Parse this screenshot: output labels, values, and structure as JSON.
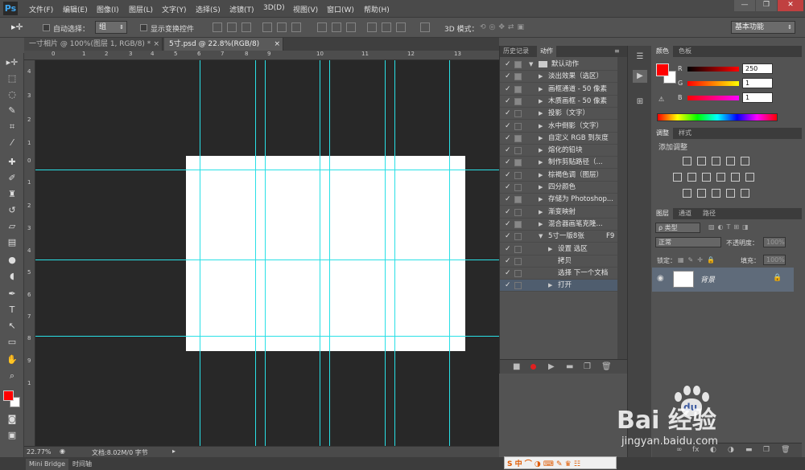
{
  "app": {
    "logo": "Ps"
  },
  "menu": [
    "文件(F)",
    "编辑(E)",
    "图像(I)",
    "图层(L)",
    "文字(Y)",
    "选择(S)",
    "滤镜(T)",
    "3D(D)",
    "视图(V)",
    "窗口(W)",
    "帮助(H)"
  ],
  "window_buttons": {
    "minimize": "—",
    "restore": "❐",
    "close": "✕"
  },
  "options": {
    "auto_select_label": "自动选择：",
    "auto_select_value": "组",
    "show_transform_label": "显示变换控件",
    "mode_3d_label": "3D 模式：",
    "workspace": "基本功能"
  },
  "doc_tabs": [
    {
      "label": "一寸相片 @ 100%(图层 1, RGB/8) *",
      "close": "×"
    },
    {
      "label": "5寸.psd @ 22.8%(RGB/8)",
      "close": "×"
    }
  ],
  "ruler_h": [
    "0",
    "1",
    "2",
    "3",
    "4",
    "5",
    "6",
    "7",
    "8",
    "9",
    "10",
    "11",
    "12",
    "13"
  ],
  "ruler_v": [
    "4",
    "3",
    "2",
    "1",
    "0",
    "1",
    "2",
    "3",
    "4",
    "5",
    "6",
    "7",
    "8",
    "9",
    "1"
  ],
  "status": {
    "zoom": "22.77%",
    "doc": "文档:8.02M/0 字节"
  },
  "bottom_tabs": [
    "Mini Bridge",
    "时间轴"
  ],
  "actions_panel": {
    "tabs": [
      "历史记录",
      "动作"
    ],
    "rows": [
      {
        "label": "默认动作",
        "level": 0,
        "expanded": true,
        "dialog": true,
        "folder": true
      },
      {
        "label": "淡出效果（选区）",
        "level": 1,
        "dialog": true
      },
      {
        "label": "画框通道 - 50 像素",
        "level": 1,
        "dialog": true
      },
      {
        "label": "木质画框 - 50 像素",
        "level": 1,
        "dialog": true
      },
      {
        "label": "投影（文字）",
        "level": 1
      },
      {
        "label": "水中倒影（文字）",
        "level": 1
      },
      {
        "label": "自定义 RGB 到灰度",
        "level": 1,
        "dialog": true
      },
      {
        "label": "熔化的铅块",
        "level": 1
      },
      {
        "label": "制作剪贴路径（...",
        "level": 1,
        "dialog": true
      },
      {
        "label": "棕褐色调（图层）",
        "level": 1
      },
      {
        "label": "四分颜色",
        "level": 1
      },
      {
        "label": "存储为 Photoshop...",
        "level": 1,
        "dialog": true
      },
      {
        "label": "渐变映射",
        "level": 1
      },
      {
        "label": "混合器画笔克隆...",
        "level": 1,
        "dialog": true
      },
      {
        "label": "5寸一版8张",
        "level": 1,
        "expanded": true,
        "shortcut": "F9"
      },
      {
        "label": "设置 选区",
        "level": 2,
        "collapsed": true
      },
      {
        "label": "拷贝",
        "level": 2
      },
      {
        "label": "选择 下一个文档",
        "level": 2
      },
      {
        "label": "打开",
        "level": 2,
        "collapsed": true,
        "selected": true
      }
    ],
    "footer": [
      "■",
      "●",
      "▶",
      "▬",
      "❐",
      "🗑"
    ]
  },
  "color_panel": {
    "tabs": [
      "颜色",
      "色板"
    ],
    "r_label": "R",
    "g_label": "G",
    "b_label": "B",
    "r": "250",
    "g": "1",
    "b": "1",
    "fg": "#ff0000"
  },
  "adjust_panel": {
    "tabs": [
      "调整",
      "样式"
    ],
    "title": "添加调整"
  },
  "layers_panel": {
    "tabs": [
      "图层",
      "通道",
      "路径"
    ],
    "filter_label": "ρ 类型",
    "blend_mode": "正常",
    "opacity_label": "不透明度：",
    "opacity_value": "100%",
    "lock_label": "锁定：",
    "fill_label": "填充：",
    "fill_value": "100%",
    "layer_name": "背景",
    "footer": [
      "∞",
      "fx",
      "◐",
      "◑",
      "▬",
      "❐",
      "🗑"
    ]
  },
  "watermark": {
    "main": "Bai  经验",
    "du": "du",
    "sub": "jingyan.baidu.com"
  },
  "ime": {
    "label": "S 中 ⌒ ◑ ⌨ ✎ ♛ ☷"
  }
}
